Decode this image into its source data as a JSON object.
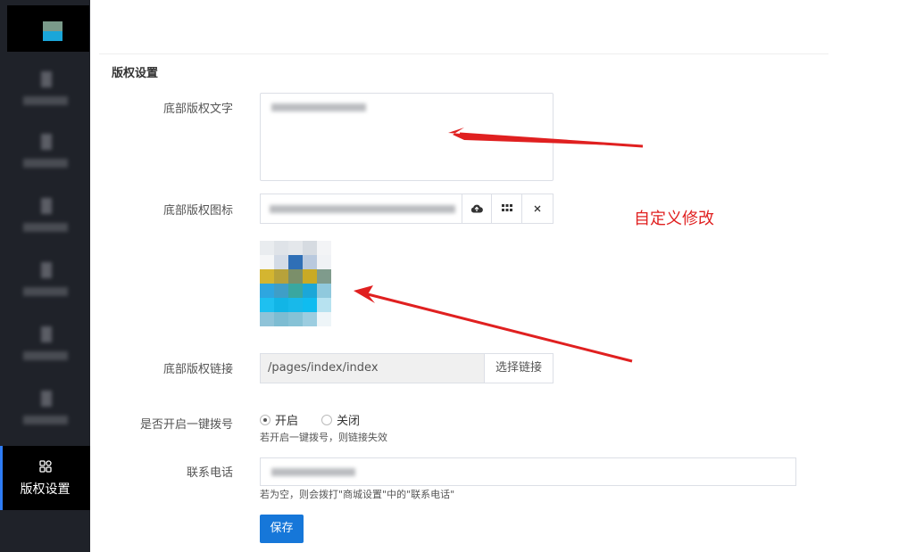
{
  "sidebar": {
    "active_item": {
      "label": "版权设置",
      "icon": "grid-icon"
    }
  },
  "section": {
    "title": "版权设置"
  },
  "form": {
    "copyright_text": {
      "label": "底部版权文字"
    },
    "copyright_icon": {
      "label": "底部版权图标",
      "upload_icon": "cloud-upload-icon",
      "gallery_icon": "grid-icon",
      "clear_icon": "close-icon"
    },
    "copyright_link": {
      "label": "底部版权链接",
      "value": "/pages/index/index",
      "choose_label": "选择链接"
    },
    "one_click_dial": {
      "label": "是否开启一键拨号",
      "options": [
        "开启",
        "关闭"
      ],
      "selected": "开启",
      "hint": "若开启一键拨号，则链接失效"
    },
    "phone": {
      "label": "联系电话",
      "hint": "若为空，则会拨打\"商城设置\"中的\"联系电话\""
    },
    "save_label": "保存"
  },
  "annotation": {
    "text": "自定义修改",
    "color": "#e02020"
  },
  "colors": {
    "sidebar_bg": "#1f2229",
    "accent": "#1677d9",
    "arrow": "#e02020"
  }
}
